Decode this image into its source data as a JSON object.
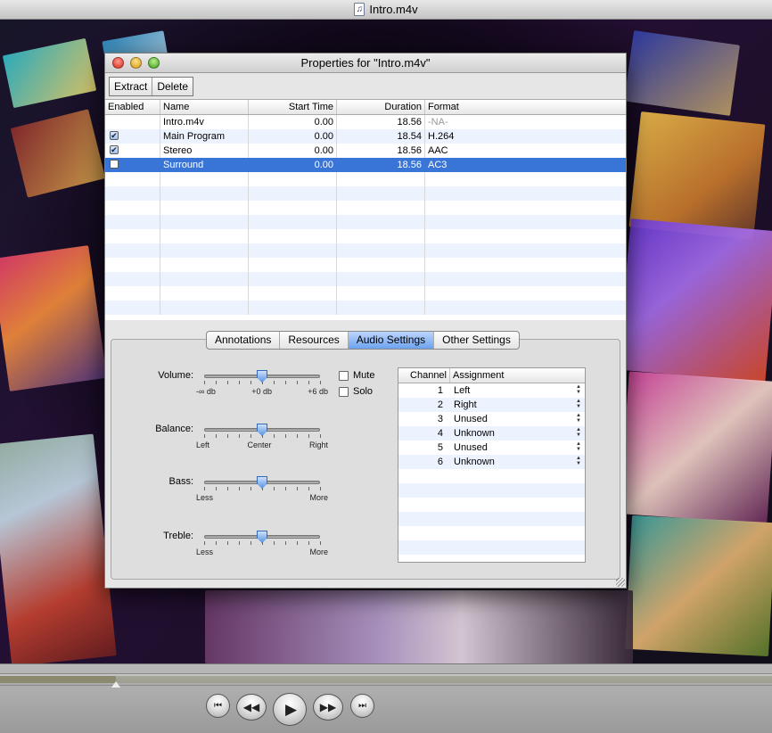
{
  "player": {
    "title": "Intro.m4v",
    "doc_icon": "music-document-icon",
    "controls": {
      "progress_fraction": 0.15,
      "buttons": [
        "skip-to-start-icon",
        "rewind-icon",
        "play-icon",
        "fast-forward-icon",
        "skip-to-end-icon"
      ]
    }
  },
  "dialog": {
    "title": "Properties for \"Intro.m4v\"",
    "toolbar": {
      "extract_label": "Extract",
      "delete_label": "Delete"
    },
    "tracks": {
      "headers": {
        "enabled": "Enabled",
        "name": "Name",
        "start_time": "Start Time",
        "duration": "Duration",
        "format": "Format"
      },
      "rows": [
        {
          "enabled": null,
          "name": "Intro.m4v",
          "start_time": "0.00",
          "duration": "18.56",
          "format": "-NA-",
          "selected": false
        },
        {
          "enabled": true,
          "name": "Main Program",
          "start_time": "0.00",
          "duration": "18.54",
          "format": "H.264",
          "selected": false
        },
        {
          "enabled": true,
          "name": "Stereo",
          "start_time": "0.00",
          "duration": "18.56",
          "format": "AAC",
          "selected": false
        },
        {
          "enabled": false,
          "name": "Surround",
          "start_time": "0.00",
          "duration": "18.56",
          "format": "AC3",
          "selected": true
        }
      ],
      "empty_rows": 10
    },
    "tabs": [
      {
        "label": "Annotations",
        "active": false
      },
      {
        "label": "Resources",
        "active": false
      },
      {
        "label": "Audio Settings",
        "active": true
      },
      {
        "label": "Other Settings",
        "active": false
      }
    ],
    "audio": {
      "sliders": [
        {
          "label": "Volume:",
          "scale": [
            "-∞ db",
            "+0 db",
            "+6 db"
          ],
          "value_fraction": 0.5
        },
        {
          "label": "Balance:",
          "scale": [
            "Left",
            "Center",
            "Right"
          ],
          "value_fraction": 0.5
        },
        {
          "label": "Bass:",
          "scale": [
            "Less",
            "More"
          ],
          "value_fraction": 0.5
        },
        {
          "label": "Treble:",
          "scale": [
            "Less",
            "More"
          ],
          "value_fraction": 0.5
        }
      ],
      "mute_label": "Mute",
      "solo_label": "Solo",
      "mute_checked": false,
      "solo_checked": false,
      "channel_table": {
        "headers": {
          "channel": "Channel",
          "assignment": "Assignment"
        },
        "rows": [
          {
            "channel": "1",
            "assignment": "Left"
          },
          {
            "channel": "2",
            "assignment": "Right"
          },
          {
            "channel": "3",
            "assignment": "Unused"
          },
          {
            "channel": "4",
            "assignment": "Unknown"
          },
          {
            "channel": "5",
            "assignment": "Unused"
          },
          {
            "channel": "6",
            "assignment": "Unknown"
          }
        ],
        "empty_rows": 6
      }
    }
  },
  "colors": {
    "selection": "#3875d7",
    "row_stripe": "#edf3fe",
    "accent": "#6da2ef"
  }
}
